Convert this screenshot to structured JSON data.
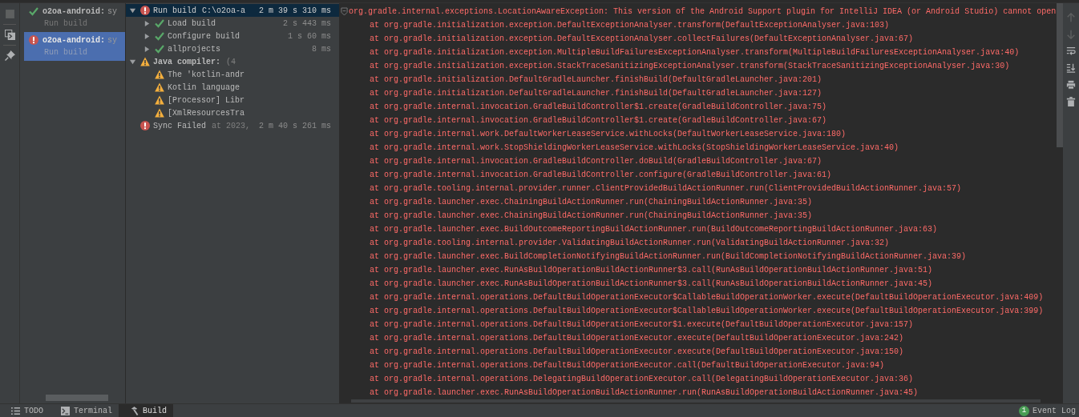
{
  "history": [
    {
      "title": "o2oa-android:",
      "detail": "sy",
      "subtitle": "Run build",
      "kind": "success",
      "selected": false
    },
    {
      "title": "o2oa-android:",
      "detail": "sy",
      "subtitle": "Run build",
      "kind": "error",
      "selected": true
    }
  ],
  "tree": [
    {
      "kind": "error",
      "label": "Run build",
      "detail": "C:\\o2oa-a",
      "duration": "2 m 39 s 310 ms",
      "selected": true,
      "expanded": true,
      "bold": false,
      "children": [
        {
          "kind": "success",
          "label": "Load build",
          "duration": "2 s 443 ms",
          "selected": false,
          "expanded": false,
          "bold": false
        },
        {
          "kind": "success",
          "label": "Configure build",
          "duration": "1 s 60 ms",
          "selected": false,
          "expanded": false,
          "bold": false
        },
        {
          "kind": "success",
          "label": "allprojects",
          "duration": "8 ms",
          "selected": false,
          "expanded": false,
          "bold": false
        }
      ]
    },
    {
      "kind": "warning",
      "label": "Java compiler:",
      "detail": "(4",
      "selected": false,
      "expanded": true,
      "bold": true,
      "children": [
        {
          "kind": "warning",
          "label": "The 'kotlin-andr",
          "selected": false,
          "bold": false
        },
        {
          "kind": "warning",
          "label": "Kotlin language",
          "selected": false,
          "bold": false
        },
        {
          "kind": "warning",
          "label": "[Processor] Libr",
          "selected": false,
          "bold": false
        },
        {
          "kind": "warning",
          "label": "[XmlResourcesTra",
          "selected": false,
          "bold": false
        }
      ]
    },
    {
      "kind": "error",
      "label": "Sync Failed",
      "detail": "at 2023,",
      "duration": "2 m 40 s 261 ms",
      "selected": false,
      "bold": false
    }
  ],
  "console": {
    "lines": [
      {
        "kind": "header",
        "text": "org.gradle.internal.exceptions.LocationAwareException: This version of the Android Support plugin for IntelliJ IDEA (or Android Studio) cannot open"
      },
      {
        "kind": "frame",
        "text": "at org.gradle.initialization.exception.DefaultExceptionAnalyser.transform(DefaultExceptionAnalyser.java:103)"
      },
      {
        "kind": "frame",
        "text": "at org.gradle.initialization.exception.DefaultExceptionAnalyser.collectFailures(DefaultExceptionAnalyser.java:67)"
      },
      {
        "kind": "frame",
        "text": "at org.gradle.initialization.exception.MultipleBuildFailuresExceptionAnalyser.transform(MultipleBuildFailuresExceptionAnalyser.java:40)"
      },
      {
        "kind": "frame",
        "text": "at org.gradle.initialization.exception.StackTraceSanitizingExceptionAnalyser.transform(StackTraceSanitizingExceptionAnalyser.java:30)"
      },
      {
        "kind": "frame",
        "text": "at org.gradle.initialization.DefaultGradleLauncher.finishBuild(DefaultGradleLauncher.java:201)"
      },
      {
        "kind": "frame",
        "text": "at org.gradle.initialization.DefaultGradleLauncher.finishBuild(DefaultGradleLauncher.java:127)"
      },
      {
        "kind": "frame",
        "text": "at org.gradle.internal.invocation.GradleBuildController$1.create(GradleBuildController.java:75)"
      },
      {
        "kind": "frame",
        "text": "at org.gradle.internal.invocation.GradleBuildController$1.create(GradleBuildController.java:67)"
      },
      {
        "kind": "frame",
        "text": "at org.gradle.internal.work.DefaultWorkerLeaseService.withLocks(DefaultWorkerLeaseService.java:180)"
      },
      {
        "kind": "frame",
        "text": "at org.gradle.internal.work.StopShieldingWorkerLeaseService.withLocks(StopShieldingWorkerLeaseService.java:40)"
      },
      {
        "kind": "frame",
        "text": "at org.gradle.internal.invocation.GradleBuildController.doBuild(GradleBuildController.java:67)"
      },
      {
        "kind": "frame",
        "text": "at org.gradle.internal.invocation.GradleBuildController.configure(GradleBuildController.java:61)"
      },
      {
        "kind": "frame",
        "text": "at org.gradle.tooling.internal.provider.runner.ClientProvidedBuildActionRunner.run(ClientProvidedBuildActionRunner.java:57)"
      },
      {
        "kind": "frame",
        "text": "at org.gradle.launcher.exec.ChainingBuildActionRunner.run(ChainingBuildActionRunner.java:35)"
      },
      {
        "kind": "frame",
        "text": "at org.gradle.launcher.exec.ChainingBuildActionRunner.run(ChainingBuildActionRunner.java:35)"
      },
      {
        "kind": "frame",
        "text": "at org.gradle.launcher.exec.BuildOutcomeReportingBuildActionRunner.run(BuildOutcomeReportingBuildActionRunner.java:63)"
      },
      {
        "kind": "frame",
        "text": "at org.gradle.tooling.internal.provider.ValidatingBuildActionRunner.run(ValidatingBuildActionRunner.java:32)"
      },
      {
        "kind": "frame",
        "text": "at org.gradle.launcher.exec.BuildCompletionNotifyingBuildActionRunner.run(BuildCompletionNotifyingBuildActionRunner.java:39)"
      },
      {
        "kind": "frame",
        "text": "at org.gradle.launcher.exec.RunAsBuildOperationBuildActionRunner$3.call(RunAsBuildOperationBuildActionRunner.java:51)"
      },
      {
        "kind": "frame",
        "text": "at org.gradle.launcher.exec.RunAsBuildOperationBuildActionRunner$3.call(RunAsBuildOperationBuildActionRunner.java:45)"
      },
      {
        "kind": "frame",
        "text": "at org.gradle.internal.operations.DefaultBuildOperationExecutor$CallableBuildOperationWorker.execute(DefaultBuildOperationExecutor.java:409)"
      },
      {
        "kind": "frame",
        "text": "at org.gradle.internal.operations.DefaultBuildOperationExecutor$CallableBuildOperationWorker.execute(DefaultBuildOperationExecutor.java:399)"
      },
      {
        "kind": "frame",
        "text": "at org.gradle.internal.operations.DefaultBuildOperationExecutor$1.execute(DefaultBuildOperationExecutor.java:157)"
      },
      {
        "kind": "frame",
        "text": "at org.gradle.internal.operations.DefaultBuildOperationExecutor.execute(DefaultBuildOperationExecutor.java:242)"
      },
      {
        "kind": "frame",
        "text": "at org.gradle.internal.operations.DefaultBuildOperationExecutor.execute(DefaultBuildOperationExecutor.java:150)"
      },
      {
        "kind": "frame",
        "text": "at org.gradle.internal.operations.DefaultBuildOperationExecutor.call(DefaultBuildOperationExecutor.java:94)"
      },
      {
        "kind": "frame",
        "text": "at org.gradle.internal.operations.DelegatingBuildOperationExecutor.call(DelegatingBuildOperationExecutor.java:36)"
      },
      {
        "kind": "frame",
        "text": "at org.gradle.launcher.exec.RunAsBuildOperationBuildActionRunner.run(RunAsBuildOperationBuildActionRunner.java:45)"
      }
    ]
  },
  "bottom_tabs": [
    {
      "kind": "todo",
      "label": "TODO",
      "selected": false
    },
    {
      "kind": "terminal",
      "label": "Terminal",
      "selected": false
    },
    {
      "kind": "build",
      "label": "Build",
      "selected": true
    }
  ],
  "event_log": {
    "label": "Event Log",
    "count": "1"
  }
}
